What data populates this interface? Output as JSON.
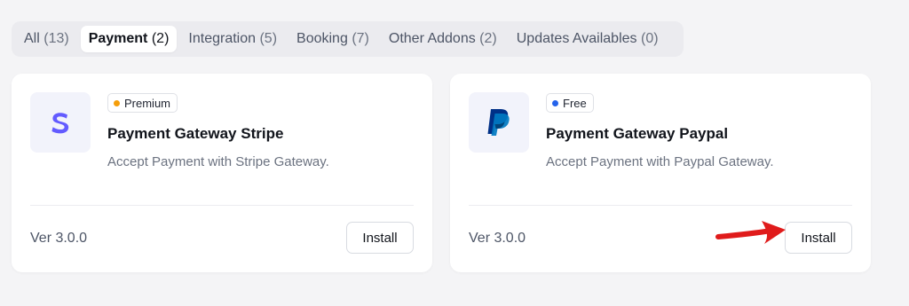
{
  "tabs": [
    {
      "label": "All",
      "count": "(13)",
      "active": false
    },
    {
      "label": "Payment",
      "count": "(2)",
      "active": true
    },
    {
      "label": "Integration",
      "count": "(5)",
      "active": false
    },
    {
      "label": "Booking",
      "count": "(7)",
      "active": false
    },
    {
      "label": "Other Addons",
      "count": "(2)",
      "active": false
    },
    {
      "label": "Updates Availables",
      "count": "(0)",
      "active": false
    }
  ],
  "addons": [
    {
      "badge": "Premium",
      "badge_color": "#f59e0b",
      "title": "Payment Gateway Stripe",
      "description": "Accept Payment with Stripe Gateway.",
      "version": "Ver 3.0.0",
      "install_label": "Install",
      "icon": "stripe-logo-icon",
      "logo_color": "#635bff"
    },
    {
      "badge": "Free",
      "badge_color": "#2563eb",
      "title": "Payment Gateway Paypal",
      "description": "Accept Payment with Paypal Gateway.",
      "version": "Ver 3.0.0",
      "install_label": "Install",
      "icon": "paypal-logo-icon",
      "logo_color": "#003087"
    }
  ],
  "annotation": {
    "icon": "red-arrow-icon",
    "color": "#e01b1b"
  }
}
